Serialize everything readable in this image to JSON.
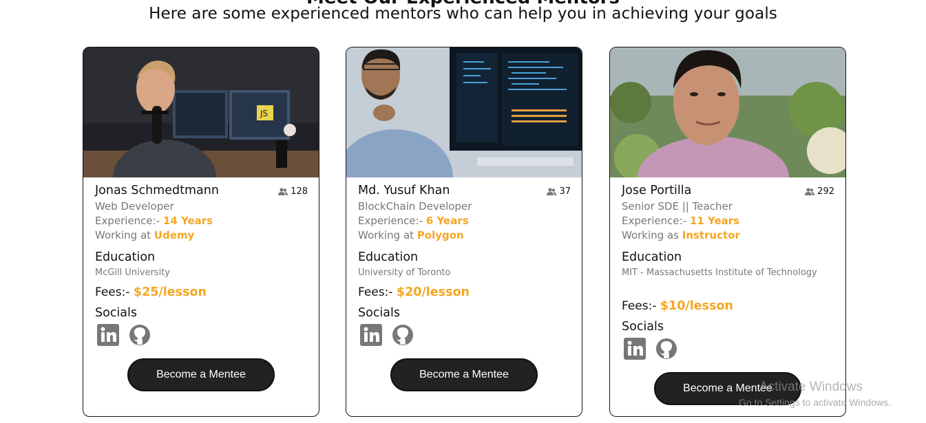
{
  "section": {
    "title": "Meet Our Experienced Mentors",
    "subtitle": "Here are some experienced mentors who can help you in achieving your goals"
  },
  "colors": {
    "accent": "#f5a623",
    "button_bg": "#222222",
    "muted": "#777777"
  },
  "mentors": [
    {
      "name": "Jonas Schmedtmann",
      "followers": "128",
      "role": "Web Developer",
      "experience_label": "Experience:- ",
      "experience_value": "14 Years",
      "work_label": "Working at ",
      "work_value": "Udemy",
      "education_heading": "Education",
      "education_value": "McGill University",
      "fees_label": "Fees:- ",
      "fees_value": "$25/lesson",
      "socials_heading": "Socials",
      "socials": [
        "linkedin-icon",
        "github-icon"
      ],
      "button_label": "Become a Mentee"
    },
    {
      "name": "Md. Yusuf Khan",
      "followers": "37",
      "role": "BlockChain Developer",
      "experience_label": "Experience:- ",
      "experience_value": "6 Years",
      "work_label": "Working at ",
      "work_value": "Polygon",
      "education_heading": "Education",
      "education_value": "University of Toronto",
      "fees_label": "Fees:- ",
      "fees_value": "$20/lesson",
      "socials_heading": "Socials",
      "socials": [
        "linkedin-icon",
        "github-icon"
      ],
      "button_label": "Become a Mentee"
    },
    {
      "name": "Jose Portilla",
      "followers": "292",
      "role": "Senior SDE || Teacher",
      "experience_label": "Experience:- ",
      "experience_value": "11 Years",
      "work_label": "Working as ",
      "work_value": "Instructor",
      "education_heading": "Education",
      "education_value": "MIT - Massachusetts Institute of Technology",
      "fees_label": "Fees:- ",
      "fees_value": "$10/lesson",
      "socials_heading": "Socials",
      "socials": [
        "linkedin-icon",
        "github-icon"
      ],
      "button_label": "Become a Mentee"
    }
  ],
  "watermark": {
    "line1": "Activate Windows",
    "line2": "Go to Settings to activate Windows."
  }
}
